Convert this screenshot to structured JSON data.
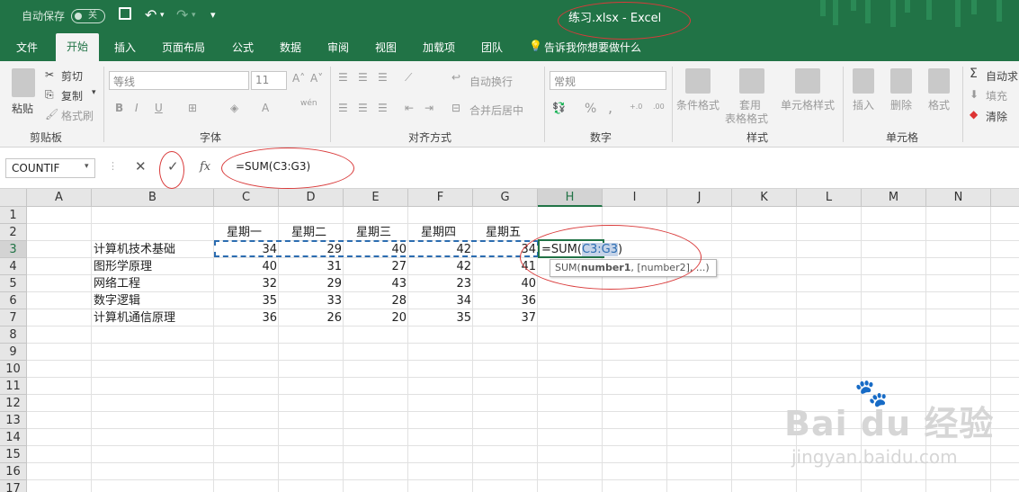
{
  "titlebar": {
    "autosave_label": "自动保存",
    "autosave_state": "关",
    "title": "练习.xlsx  -  Excel",
    "qat_dropdown": "▾"
  },
  "tabs": [
    {
      "label": "文件",
      "active": false
    },
    {
      "label": "开始",
      "active": true
    },
    {
      "label": "插入",
      "active": false
    },
    {
      "label": "页面布局",
      "active": false
    },
    {
      "label": "公式",
      "active": false
    },
    {
      "label": "数据",
      "active": false
    },
    {
      "label": "审阅",
      "active": false
    },
    {
      "label": "视图",
      "active": false
    },
    {
      "label": "加载项",
      "active": false
    },
    {
      "label": "团队",
      "active": false
    }
  ],
  "tell_me": "告诉我你想要做什么",
  "ribbon": {
    "clipboard": {
      "paste": "粘贴",
      "cut": "剪切",
      "copy": "复制",
      "format_painter": "格式刷",
      "group": "剪贴板"
    },
    "font": {
      "font_name": "等线",
      "font_size": "11",
      "bold": "B",
      "italic": "I",
      "underline": "U",
      "font_color": "A",
      "wen": "wén",
      "group": "字体"
    },
    "alignment": {
      "wrap": "自动换行",
      "merge": "合并后居中",
      "group": "对齐方式"
    },
    "number": {
      "format": "常规",
      "percent": "%",
      "comma": ",",
      "group": "数字"
    },
    "styles": {
      "conditional": "条件格式",
      "table_1": "套用",
      "table_2": "表格格式",
      "cell_styles": "单元格样式",
      "group": "样式"
    },
    "cells": {
      "insert": "插入",
      "delete": "删除",
      "format": "格式",
      "group": "单元格"
    },
    "editing": {
      "autosum": "自动求",
      "fill": "填充",
      "clear": "清除"
    }
  },
  "formula_bar": {
    "name_box": "COUNTIF",
    "cancel": "✕",
    "enter": "✓",
    "fx": "fx",
    "formula": "=SUM(C3:G3)"
  },
  "columns": [
    "A",
    "B",
    "C",
    "D",
    "E",
    "F",
    "G",
    "H",
    "I",
    "J",
    "K",
    "L",
    "M",
    "N"
  ],
  "selected_column": "H",
  "rows": [
    "1",
    "2",
    "3",
    "4",
    "5",
    "6",
    "7",
    "8",
    "9",
    "10",
    "11",
    "12",
    "13",
    "14",
    "15",
    "16",
    "17"
  ],
  "selected_row": "3",
  "headers": [
    "星期一",
    "星期二",
    "星期三",
    "星期四",
    "星期五"
  ],
  "courses": [
    {
      "name": "计算机技术基础",
      "values": [
        "34",
        "29",
        "40",
        "42",
        "34"
      ]
    },
    {
      "name": "图形学原理",
      "values": [
        "40",
        "31",
        "27",
        "42",
        "41"
      ]
    },
    {
      "name": "网络工程",
      "values": [
        "32",
        "29",
        "43",
        "23",
        "40"
      ]
    },
    {
      "name": "数字逻辑",
      "values": [
        "35",
        "33",
        "28",
        "34",
        "36"
      ]
    },
    {
      "name": "计算机通信原理",
      "values": [
        "36",
        "26",
        "20",
        "35",
        "37"
      ]
    }
  ],
  "active_cell": {
    "prefix": "=SUM(",
    "ref": "C3:G3",
    "suffix": ")"
  },
  "tooltip": {
    "fn": "SUM(",
    "arg1": "number1",
    "rest": ", [number2], ...)"
  },
  "watermark": {
    "brand": "Bai du 经验",
    "url": "jingyan.baidu.com"
  },
  "colors": {
    "excel_green": "#217346",
    "annotation_red": "#d93a3a",
    "ref_blue": "#2b6cb0"
  }
}
